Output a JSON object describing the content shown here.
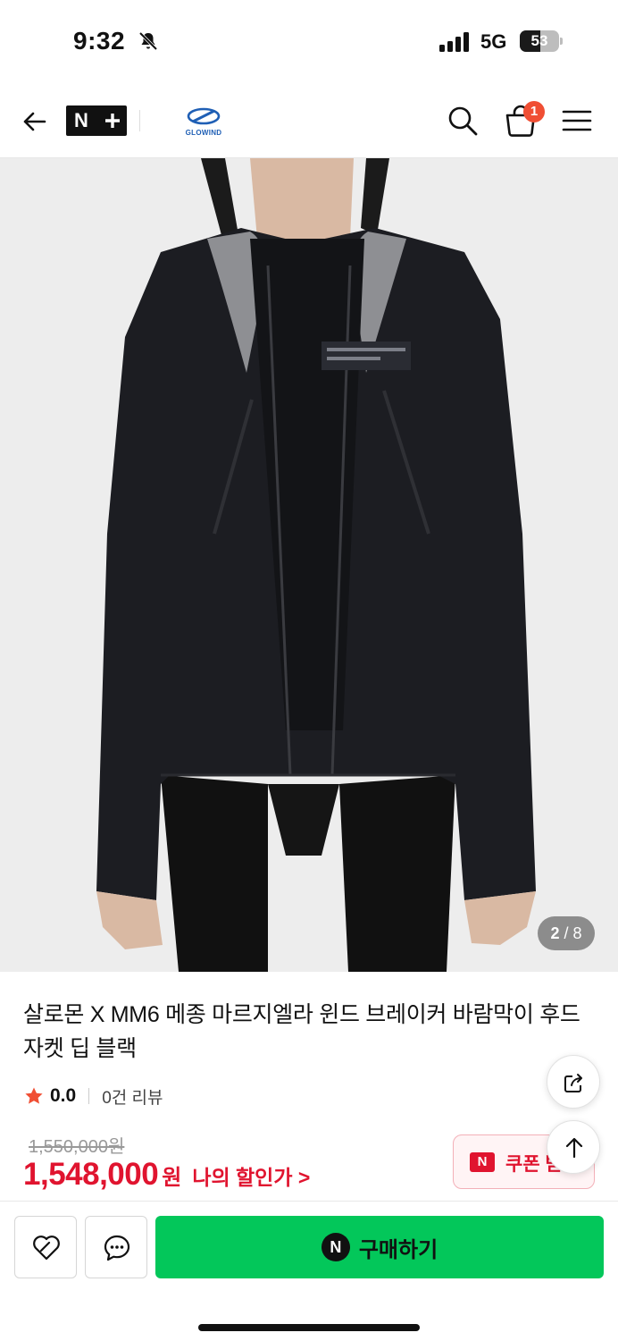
{
  "status_bar": {
    "time": "9:32",
    "network": "5G",
    "battery": "53",
    "battery_level": 0.53
  },
  "header": {
    "brand_badge": "N+",
    "brand_name": "GLOWIND",
    "cart_count": "1"
  },
  "gallery": {
    "current": "2",
    "separator": "/",
    "total": "8"
  },
  "product": {
    "title": "살로몬 X MM6 메종 마르지엘라 윈드 브레이커 바람막이 후드 자켓 딥 블랙",
    "rating": "0.0",
    "review_count": "0건 리뷰",
    "original_price": "1,550,000원",
    "sale_price": "1,548,000",
    "sale_unit": "원",
    "my_discount": "나의 할인가 >"
  },
  "coupon": {
    "badge": "N",
    "label": "쿠폰 받"
  },
  "bottom_bar": {
    "buy_badge": "N",
    "buy_label": "구매하기"
  },
  "colors": {
    "accent_red": "#e0142f",
    "naver_green": "#03c75a",
    "badge_orange": "#f04f34"
  },
  "icons": [
    "back-arrow-icon",
    "search-icon",
    "cart-icon",
    "menu-icon",
    "share-icon",
    "arrow-up-icon",
    "heart-icon",
    "chat-icon",
    "star-icon",
    "bell-muted-icon",
    "signal-icon",
    "battery-icon"
  ]
}
